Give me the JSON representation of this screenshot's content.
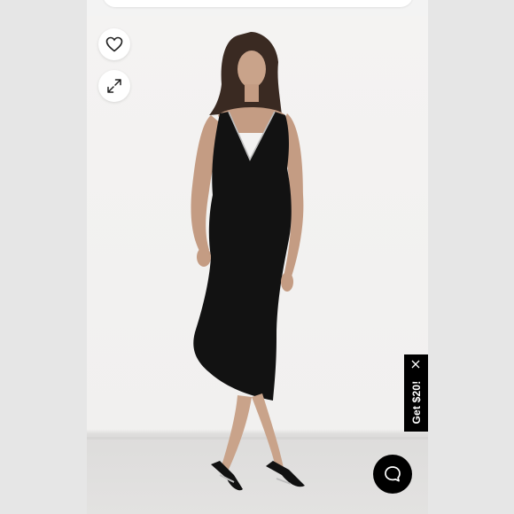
{
  "promo": {
    "label": "Get $20!"
  },
  "icons": {
    "wishlist": "heart-icon",
    "expand": "expand-icon",
    "close": "close-icon",
    "chat": "chat-icon"
  },
  "colors": {
    "page_background": "#e9e9e9",
    "panel_background": "#ffffff",
    "dress": "#121212",
    "promo_background": "#000000",
    "chat_button": "#000000"
  }
}
